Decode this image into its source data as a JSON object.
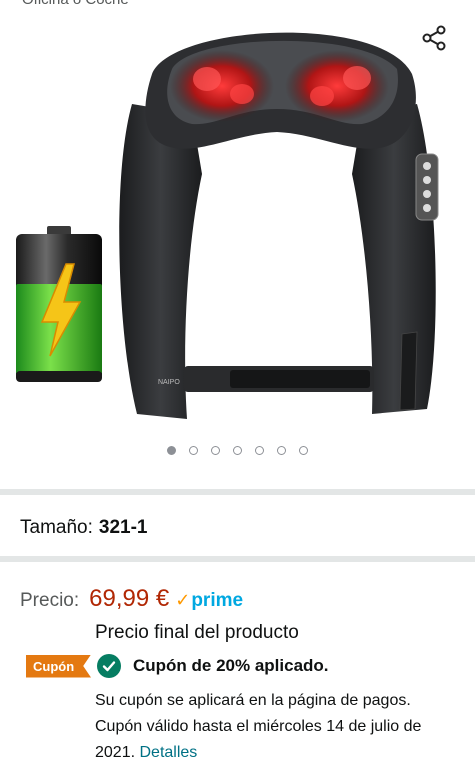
{
  "header": {
    "cut_text": "Oficina o Coche"
  },
  "gallery": {
    "brand_on_product": "NAIPO",
    "total_images": 7,
    "active_index": 0
  },
  "icons": {
    "share": "share-icon",
    "coupon_check": "check-circle-icon",
    "battery": "battery-charging-icon"
  },
  "product": {
    "size_label": "Tamaño:",
    "size_value": "321-1",
    "price_label": "Precio:",
    "price_value": "69,99 €",
    "prime_check": "✓",
    "prime_label": "prime",
    "final_price_note": "Precio final del producto"
  },
  "coupon": {
    "badge": "Cupón",
    "applied_text": "Cupón de 20% aplicado.",
    "note_line1": "Su cupón se aplicará en la página de pagos.",
    "note_line2": "Cupón válido hasta el miércoles 14 de julio de 2021.",
    "details_link": "Detalles"
  },
  "colors": {
    "price": "#b12704",
    "prime": "#00a8e1",
    "coupon_badge": "#e47911",
    "coupon_check": "#067d62",
    "link": "#007185",
    "divider": "#e3e6e6"
  }
}
